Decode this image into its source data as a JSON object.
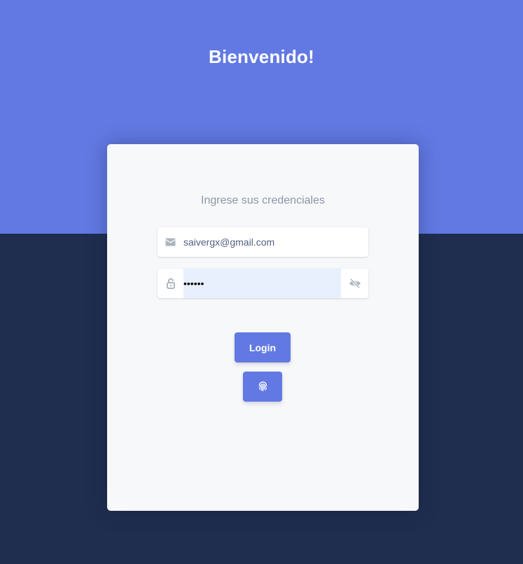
{
  "header": {
    "title": "Bienvenido!"
  },
  "login_card": {
    "subtitle": "Ingrese sus credenciales",
    "email": {
      "value": "saivergx@gmail.com",
      "icon": "envelope-icon"
    },
    "password": {
      "value": "pppppp",
      "icon": "lock-open-icon",
      "toggle_icon": "eye-slash-icon"
    },
    "login_button": {
      "label": "Login"
    },
    "fingerprint_button": {
      "icon": "fingerprint-icon"
    }
  },
  "colors": {
    "primary": "#6279e3",
    "background_dark": "#1f2d4e",
    "card": "#f7f8fa",
    "autofill": "#e8effd",
    "muted_text": "#8c96a6"
  }
}
